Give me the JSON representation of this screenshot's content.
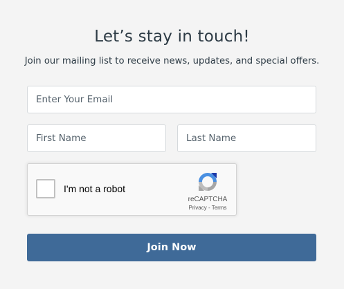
{
  "signup": {
    "title": "Let’s stay in touch!",
    "subtitle": "Join our mailing list to receive news, updates, and special offers.",
    "email_placeholder": "Enter Your Email",
    "first_name_placeholder": "First Name",
    "last_name_placeholder": "Last Name",
    "submit_label": "Join Now"
  },
  "recaptcha": {
    "checkbox_label": "I'm not a robot",
    "brand": "reCAPTCHA",
    "privacy_label": "Privacy",
    "separator": " - ",
    "terms_label": "Terms",
    "logo_icon": "recaptcha-logo-icon",
    "checked": false
  },
  "colors": {
    "button_bg": "#3f6a98",
    "text": "#2d3b45",
    "background": "#f4f4f4"
  }
}
